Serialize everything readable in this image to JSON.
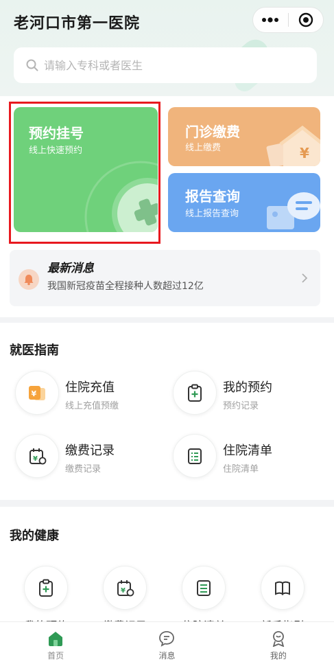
{
  "header": {
    "title": "老河口市第一医院",
    "capsule": {
      "more_icon": "more-dots-icon",
      "close_icon": "target-circle-icon"
    }
  },
  "search": {
    "placeholder": "请输入专科或者医生",
    "value": ""
  },
  "cards": {
    "appointment": {
      "title": "预约挂号",
      "subtitle": "线上快速预约"
    },
    "payment": {
      "title": "门诊缴费",
      "subtitle": "线上缴费"
    },
    "report": {
      "title": "报告查询",
      "subtitle": "线上报告查询"
    }
  },
  "news": {
    "title": "最新消息",
    "text": "我国新冠疫苗全程接种人数超过12亿"
  },
  "guide": {
    "heading": "就医指南",
    "items": [
      {
        "name": "住院充值",
        "sub": "线上充值预缴"
      },
      {
        "name": "我的预约",
        "sub": "预约记录"
      },
      {
        "name": "缴费记录",
        "sub": "缴费记录"
      },
      {
        "name": "住院清单",
        "sub": "住院清单"
      }
    ]
  },
  "health": {
    "heading": "我的健康",
    "items": [
      {
        "label": "我的预约"
      },
      {
        "label": "缴费记录"
      },
      {
        "label": "住院清单"
      },
      {
        "label": "新手指引"
      }
    ]
  },
  "tabbar": {
    "items": [
      {
        "label": "首页"
      },
      {
        "label": "消息"
      },
      {
        "label": "我的"
      }
    ]
  },
  "colors": {
    "accent_green": "#6fd17b",
    "card_orange": "#f0b47c",
    "card_blue": "#6aa6f0",
    "icon_green": "#2f9a55",
    "highlight_red": "#e8191f"
  }
}
